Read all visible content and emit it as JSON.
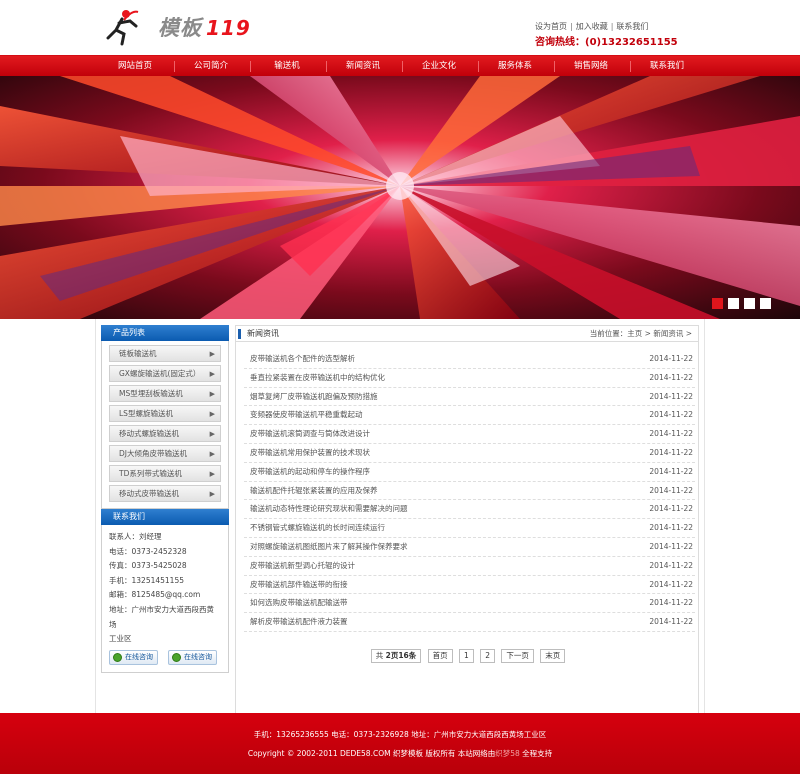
{
  "header": {
    "logo_text": "模板",
    "logo_number": "119",
    "toplinks": [
      "设为首页",
      "加入收藏",
      "联系我们"
    ],
    "hotline_label": "咨询热线：",
    "hotline_number": "(0)13232651155"
  },
  "nav": {
    "items": [
      "网站首页",
      "公司简介",
      "输送机",
      "新闻资讯",
      "企业文化",
      "服务体系",
      "销售网络",
      "联系我们"
    ]
  },
  "banner": {
    "slides": 4,
    "active_slide": 1,
    "accent_color": "#e0151c"
  },
  "sidebar": {
    "products_title": "产品列表",
    "products": [
      "链板输送机",
      "GX螺旋输送机(固定式）",
      "MS型埋刮板输送机",
      "LS型螺旋输送机",
      "移动式螺旋输送机",
      "DJ大倾角皮带输送机",
      "TD系列带式输送机",
      "移动式皮带输送机"
    ],
    "contact_title": "联系我们",
    "contact_lines": [
      "联系人：刘经理",
      "电话：0373-2452328",
      "传真：0373-5425028",
      "手机：13251451155",
      "邮箱：8125485@qq.com",
      "地址：广州市安力大道西段西黄场",
      "工业区"
    ],
    "qq_buttons": [
      "在线咨询",
      "在线咨询"
    ]
  },
  "main": {
    "title": "新闻资讯",
    "breadcrumb": "当前位置：主页 > 新闻资讯 >",
    "news": [
      {
        "title": "皮带输送机各个配件的选型解析",
        "date": "2014-11-22"
      },
      {
        "title": "垂直拉紧装置在皮带输送机中的结构优化",
        "date": "2014-11-22"
      },
      {
        "title": "烟草复烤厂皮带输送机跑偏及预防措施",
        "date": "2014-11-22"
      },
      {
        "title": "变频器使皮带输送机平稳重载起动",
        "date": "2014-11-22"
      },
      {
        "title": "皮带输送机滚筒调查与筒体改进设计",
        "date": "2014-11-22"
      },
      {
        "title": "皮带输送机常用保护装置的技术现状",
        "date": "2014-11-22"
      },
      {
        "title": "皮带输送机的起动和停车的操作程序",
        "date": "2014-11-22"
      },
      {
        "title": "输送机配件托辊张紧装置的应用及保养",
        "date": "2014-11-22"
      },
      {
        "title": "输送机动态特性理论研究现状和需要解决的问题",
        "date": "2014-11-22"
      },
      {
        "title": "不锈钢管式螺旋输送机的长时间连续运行",
        "date": "2014-11-22"
      },
      {
        "title": "对照螺旋输送机图纸图片来了解其操作保养要求",
        "date": "2014-11-22"
      },
      {
        "title": "皮带输送机新型调心托辊的设计",
        "date": "2014-11-22"
      },
      {
        "title": "皮带输送机部件输送带的衔接",
        "date": "2014-11-22"
      },
      {
        "title": "如何选购皮带输送机配输送带",
        "date": "2014-11-22"
      },
      {
        "title": "解析皮带输送机配件液力装置",
        "date": "2014-11-22"
      }
    ],
    "pager": {
      "summary_prefix": "共",
      "summary_pages": "2页16条",
      "first": "首页",
      "pages": [
        "1",
        "2"
      ],
      "next": "下一页",
      "last": "末页"
    }
  },
  "footer": {
    "line1": "手机：13265236555 电话：0373-2326928 地址：广州市安力大道西段西黄场工业区",
    "line2_a": "Copyright © 2002-2011 DEDE58.COM 织梦模板 版权所有 本站网络由",
    "line2_dim": "织梦58",
    "line2_b": "全程支持"
  }
}
